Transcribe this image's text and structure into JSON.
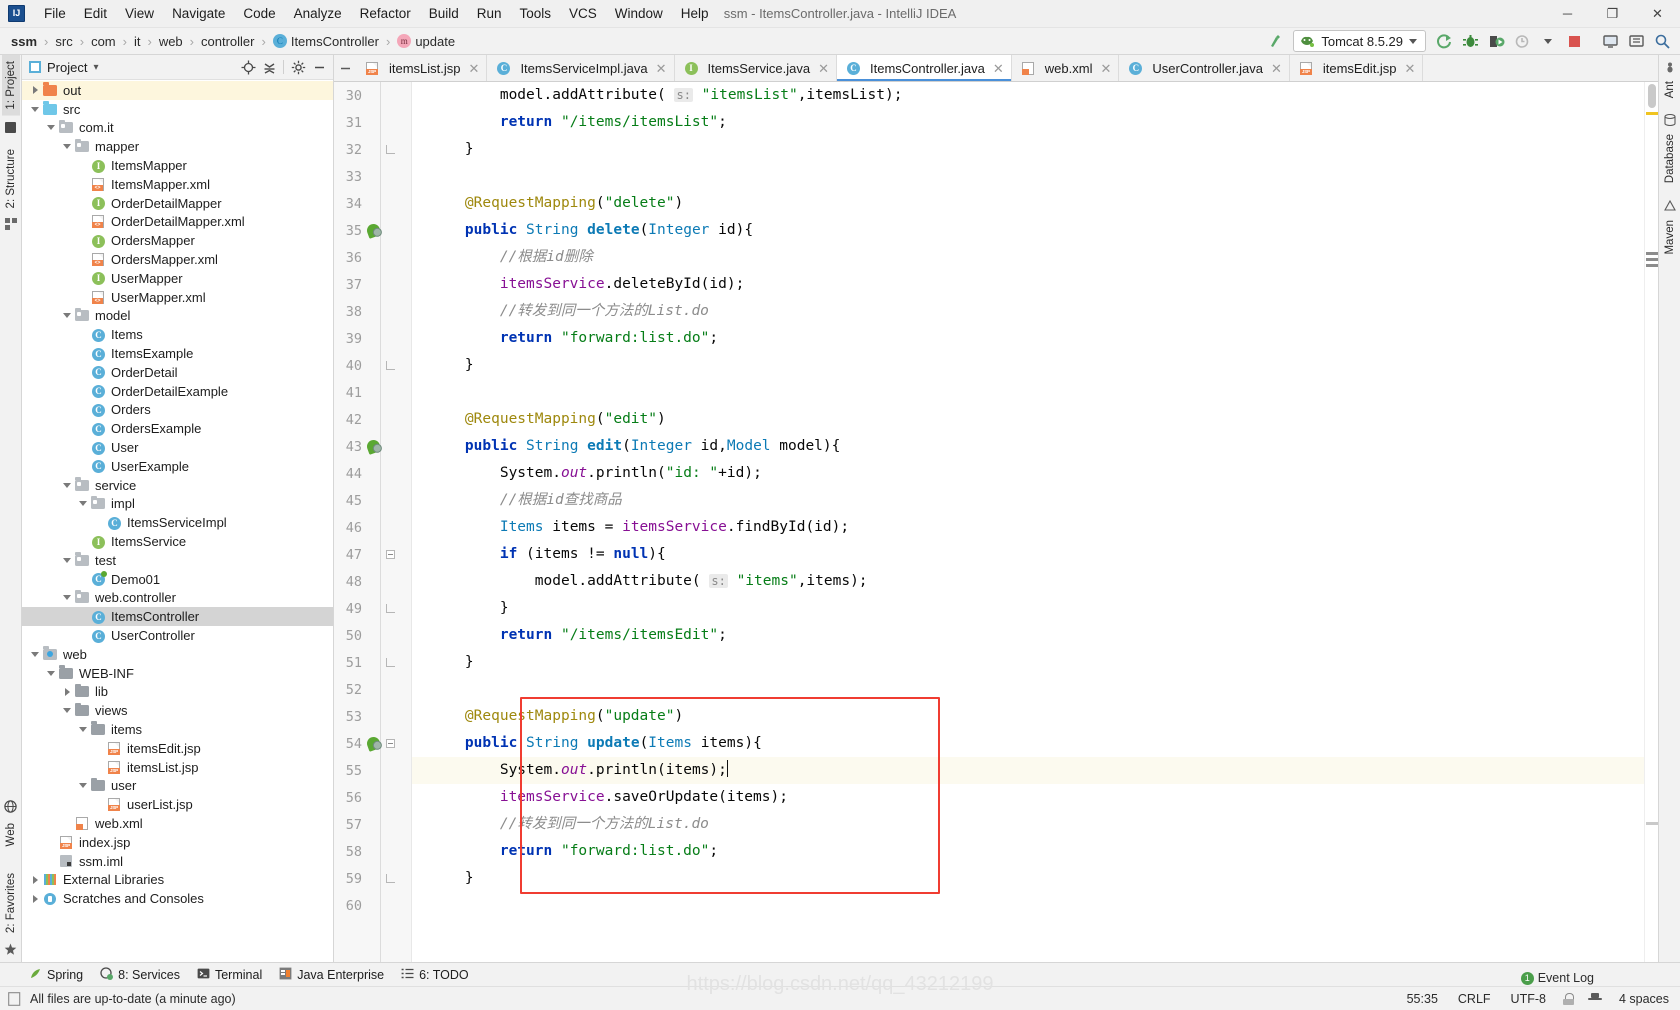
{
  "window": {
    "title": "ssm - ItemsController.java - IntelliJ IDEA",
    "logo": "IJ",
    "minimize": "─",
    "maximize": "❐",
    "close": "✕"
  },
  "menu": [
    {
      "label": "File"
    },
    {
      "label": "Edit"
    },
    {
      "label": "View"
    },
    {
      "label": "Navigate"
    },
    {
      "label": "Code"
    },
    {
      "label": "Analyze"
    },
    {
      "label": "Refactor"
    },
    {
      "label": "Build"
    },
    {
      "label": "Run"
    },
    {
      "label": "Tools"
    },
    {
      "label": "VCS"
    },
    {
      "label": "Window"
    },
    {
      "label": "Help"
    }
  ],
  "breadcrumb": {
    "items": [
      {
        "label": "ssm",
        "icon": null,
        "bold": true
      },
      {
        "label": "src",
        "icon": null,
        "bold": false
      },
      {
        "label": "com",
        "icon": null,
        "bold": false
      },
      {
        "label": "it",
        "icon": null,
        "bold": false
      },
      {
        "label": "web",
        "icon": null,
        "bold": false
      },
      {
        "label": "controller",
        "icon": null,
        "bold": false
      },
      {
        "label": "ItemsController",
        "icon": "class-icon",
        "bold": false
      },
      {
        "label": "update",
        "icon": "method-icon",
        "bold": false
      }
    ],
    "separator": "›"
  },
  "toolbar": {
    "run_config": "Tomcat 8.5.29",
    "run_config_icon": "tomcat-cat-icon",
    "buttons": [
      {
        "name": "make-project-icon",
        "glyph": "↖"
      },
      {
        "name": "run-icon",
        "glyph": "⟳"
      },
      {
        "name": "debug-icon",
        "glyph": "🐞"
      },
      {
        "name": "run-coverage-icon",
        "glyph": "▶"
      },
      {
        "name": "profile-icon",
        "glyph": "◔"
      },
      {
        "name": "stop-icon",
        "glyph": "■"
      },
      {
        "name": "update-app-icon",
        "glyph": "⭯"
      },
      {
        "name": "settings-icon",
        "glyph": "⚙"
      },
      {
        "name": "search-everywhere-icon",
        "glyph": "🔍"
      }
    ]
  },
  "left_rail": {
    "top": [
      {
        "label": "1: Project",
        "icon": "project-icon",
        "active": true
      },
      {
        "label": "2: Structure",
        "icon": "structure-icon",
        "active": false
      }
    ],
    "bottom": [
      {
        "label": "2: Favorites",
        "icon": "favorites-icon"
      },
      {
        "label": "Web",
        "icon": "web-icon"
      }
    ]
  },
  "right_rail": {
    "items": [
      {
        "label": "Ant",
        "icon": "ant-icon"
      },
      {
        "label": "Database",
        "icon": "database-icon"
      },
      {
        "label": "Maven",
        "icon": "maven-icon"
      }
    ]
  },
  "project_panel": {
    "title": "Project",
    "dropdown_caret": "▾",
    "actions": [
      {
        "name": "locate-icon",
        "glyph": "⊕"
      },
      {
        "name": "collapse-all-icon",
        "glyph": "⨍"
      },
      {
        "name": "settings-gear-icon",
        "glyph": "⚙"
      },
      {
        "name": "hide-icon",
        "glyph": "─"
      }
    ],
    "tree": [
      {
        "label": "out",
        "depth": 1,
        "icon": "folder-orange",
        "arrow": "right",
        "state": "normal"
      },
      {
        "label": "src",
        "depth": 1,
        "icon": "folder-blue",
        "arrow": "down",
        "state": "normal"
      },
      {
        "label": "com.it",
        "depth": 2,
        "icon": "package",
        "arrow": "down",
        "state": "normal"
      },
      {
        "label": "mapper",
        "depth": 3,
        "icon": "package",
        "arrow": "down",
        "state": "normal"
      },
      {
        "label": "ItemsMapper",
        "depth": 4,
        "icon": "interface",
        "arrow": "none",
        "state": "normal"
      },
      {
        "label": "ItemsMapper.xml",
        "depth": 4,
        "icon": "xml",
        "arrow": "none",
        "state": "normal"
      },
      {
        "label": "OrderDetailMapper",
        "depth": 4,
        "icon": "interface",
        "arrow": "none",
        "state": "normal"
      },
      {
        "label": "OrderDetailMapper.xml",
        "depth": 4,
        "icon": "xml",
        "arrow": "none",
        "state": "normal"
      },
      {
        "label": "OrdersMapper",
        "depth": 4,
        "icon": "interface",
        "arrow": "none",
        "state": "normal"
      },
      {
        "label": "OrdersMapper.xml",
        "depth": 4,
        "icon": "xml",
        "arrow": "none",
        "state": "normal"
      },
      {
        "label": "UserMapper",
        "depth": 4,
        "icon": "interface",
        "arrow": "none",
        "state": "normal"
      },
      {
        "label": "UserMapper.xml",
        "depth": 4,
        "icon": "xml",
        "arrow": "none",
        "state": "normal"
      },
      {
        "label": "model",
        "depth": 3,
        "icon": "package",
        "arrow": "down",
        "state": "normal"
      },
      {
        "label": "Items",
        "depth": 4,
        "icon": "class",
        "arrow": "none",
        "state": "normal"
      },
      {
        "label": "ItemsExample",
        "depth": 4,
        "icon": "class",
        "arrow": "none",
        "state": "normal"
      },
      {
        "label": "OrderDetail",
        "depth": 4,
        "icon": "class",
        "arrow": "none",
        "state": "normal"
      },
      {
        "label": "OrderDetailExample",
        "depth": 4,
        "icon": "class",
        "arrow": "none",
        "state": "normal"
      },
      {
        "label": "Orders",
        "depth": 4,
        "icon": "class",
        "arrow": "none",
        "state": "normal"
      },
      {
        "label": "OrdersExample",
        "depth": 4,
        "icon": "class",
        "arrow": "none",
        "state": "normal"
      },
      {
        "label": "User",
        "depth": 4,
        "icon": "class",
        "arrow": "none",
        "state": "normal"
      },
      {
        "label": "UserExample",
        "depth": 4,
        "icon": "class",
        "arrow": "none",
        "state": "normal"
      },
      {
        "label": "service",
        "depth": 3,
        "icon": "package",
        "arrow": "down",
        "state": "normal"
      },
      {
        "label": "impl",
        "depth": 4,
        "icon": "package",
        "arrow": "down",
        "state": "normal"
      },
      {
        "label": "ItemsServiceImpl",
        "depth": 5,
        "icon": "class",
        "arrow": "none",
        "state": "normal"
      },
      {
        "label": "ItemsService",
        "depth": 4,
        "icon": "interface",
        "arrow": "none",
        "state": "normal"
      },
      {
        "label": "test",
        "depth": 3,
        "icon": "package",
        "arrow": "down",
        "state": "normal"
      },
      {
        "label": "Demo01",
        "depth": 4,
        "icon": "class-test",
        "arrow": "none",
        "state": "normal"
      },
      {
        "label": "web.controller",
        "depth": 3,
        "icon": "package",
        "arrow": "down",
        "state": "normal"
      },
      {
        "label": "ItemsController",
        "depth": 4,
        "icon": "class",
        "arrow": "none",
        "state": "selected"
      },
      {
        "label": "UserController",
        "depth": 4,
        "icon": "class",
        "arrow": "none",
        "state": "normal"
      },
      {
        "label": "web",
        "depth": 1,
        "icon": "folder-web",
        "arrow": "down",
        "state": "normal"
      },
      {
        "label": "WEB-INF",
        "depth": 2,
        "icon": "folder-grey",
        "arrow": "down",
        "state": "normal"
      },
      {
        "label": "lib",
        "depth": 3,
        "icon": "folder-grey",
        "arrow": "right",
        "state": "normal"
      },
      {
        "label": "views",
        "depth": 3,
        "icon": "folder-grey",
        "arrow": "down",
        "state": "normal"
      },
      {
        "label": "items",
        "depth": 4,
        "icon": "folder-grey",
        "arrow": "down",
        "state": "normal"
      },
      {
        "label": "itemsEdit.jsp",
        "depth": 5,
        "icon": "jsp",
        "arrow": "none",
        "state": "normal"
      },
      {
        "label": "itemsList.jsp",
        "depth": 5,
        "icon": "jsp",
        "arrow": "none",
        "state": "normal"
      },
      {
        "label": "user",
        "depth": 4,
        "icon": "folder-grey",
        "arrow": "down",
        "state": "normal"
      },
      {
        "label": "userList.jsp",
        "depth": 5,
        "icon": "jsp",
        "arrow": "none",
        "state": "normal"
      },
      {
        "label": "web.xml",
        "depth": 3,
        "icon": "webxml",
        "arrow": "none",
        "state": "normal"
      },
      {
        "label": "index.jsp",
        "depth": 2,
        "icon": "jsp",
        "arrow": "none",
        "state": "normal"
      },
      {
        "label": "ssm.iml",
        "depth": 2,
        "icon": "iml",
        "arrow": "none",
        "state": "normal"
      },
      {
        "label": "External Libraries",
        "depth": 1,
        "icon": "library",
        "arrow": "right",
        "state": "normal"
      },
      {
        "label": "Scratches and Consoles",
        "depth": 1,
        "icon": "scratches",
        "arrow": "right",
        "state": "normal"
      }
    ]
  },
  "editor_tabs": [
    {
      "label": "itemsList.jsp",
      "icon": "jsp",
      "active": false,
      "closable": true
    },
    {
      "label": "ItemsServiceImpl.java",
      "icon": "class",
      "active": false,
      "closable": true
    },
    {
      "label": "ItemsService.java",
      "icon": "interface",
      "active": false,
      "closable": true
    },
    {
      "label": "ItemsController.java",
      "icon": "class",
      "active": true,
      "closable": true
    },
    {
      "label": "web.xml",
      "icon": "webxml",
      "active": false,
      "closable": true
    },
    {
      "label": "UserController.java",
      "icon": "class",
      "active": false,
      "closable": true
    },
    {
      "label": "itemsEdit.jsp",
      "icon": "jsp",
      "active": false,
      "closable": true
    }
  ],
  "editor": {
    "first_visible_line": 30,
    "last_visible_line": 60,
    "highlighted_lines": [
      55
    ],
    "bean_gutter_lines": [
      35,
      43,
      54
    ],
    "fold_lines": [
      32,
      40,
      47,
      49,
      51,
      54,
      59
    ],
    "lines": [
      {
        "n": 30,
        "text": "        model.addAttribute( s: \"itemsList\",itemsList);",
        "clipped": true
      },
      {
        "n": 31,
        "text": "        return \"/items/itemsList\";"
      },
      {
        "n": 32,
        "text": "    }"
      },
      {
        "n": 33,
        "text": ""
      },
      {
        "n": 34,
        "text": "    @RequestMapping(\"delete\")"
      },
      {
        "n": 35,
        "text": "    public String delete(Integer id){"
      },
      {
        "n": 36,
        "text": "        //根据id删除"
      },
      {
        "n": 37,
        "text": "        itemsService.deleteById(id);"
      },
      {
        "n": 38,
        "text": "        //转发到同一个方法的List.do"
      },
      {
        "n": 39,
        "text": "        return \"forward:list.do\";"
      },
      {
        "n": 40,
        "text": "    }"
      },
      {
        "n": 41,
        "text": ""
      },
      {
        "n": 42,
        "text": "    @RequestMapping(\"edit\")"
      },
      {
        "n": 43,
        "text": "    public String edit(Integer id,Model model){"
      },
      {
        "n": 44,
        "text": "        System.out.println(\"id: \"+id);"
      },
      {
        "n": 45,
        "text": "        //根据id查找商品"
      },
      {
        "n": 46,
        "text": "        Items items = itemsService.findById(id);"
      },
      {
        "n": 47,
        "text": "        if (items != null){"
      },
      {
        "n": 48,
        "text": "            model.addAttribute( s: \"items\",items);"
      },
      {
        "n": 49,
        "text": "        }"
      },
      {
        "n": 50,
        "text": "        return \"/items/itemsEdit\";"
      },
      {
        "n": 51,
        "text": "    }"
      },
      {
        "n": 52,
        "text": ""
      },
      {
        "n": 53,
        "text": "    @RequestMapping(\"update\")"
      },
      {
        "n": 54,
        "text": "    public String update(Items items){"
      },
      {
        "n": 55,
        "text": "        System.out.println(items);"
      },
      {
        "n": 56,
        "text": "        itemsService.saveOrUpdate(items);"
      },
      {
        "n": 57,
        "text": "        //转发到同一个方法的List.do"
      },
      {
        "n": 58,
        "text": "        return \"forward:list.do\";"
      },
      {
        "n": 59,
        "text": "    }"
      },
      {
        "n": 60,
        "text": ""
      }
    ]
  },
  "bottom_tools": [
    {
      "label": "Spring",
      "icon": "spring-leaf-icon"
    },
    {
      "label": "8: Services",
      "icon": "services-icon"
    },
    {
      "label": "Terminal",
      "icon": "terminal-icon"
    },
    {
      "label": "Java Enterprise",
      "icon": "java-enterprise-icon"
    },
    {
      "label": "6: TODO",
      "icon": "todo-icon"
    }
  ],
  "status_bar": {
    "message": "All files are up-to-date (a minute ago)",
    "message_icon": "file-icon",
    "event_log": "Event Log",
    "event_count": "1",
    "caret_position": "55:35",
    "line_separator": "CRLF",
    "encoding": "UTF-8",
    "lock_icon": "unlocked-icon",
    "hat_icon": "inspector-hat-icon",
    "indent": "4 spaces"
  },
  "watermark": "https://blog.csdn.net/qq_43212199"
}
